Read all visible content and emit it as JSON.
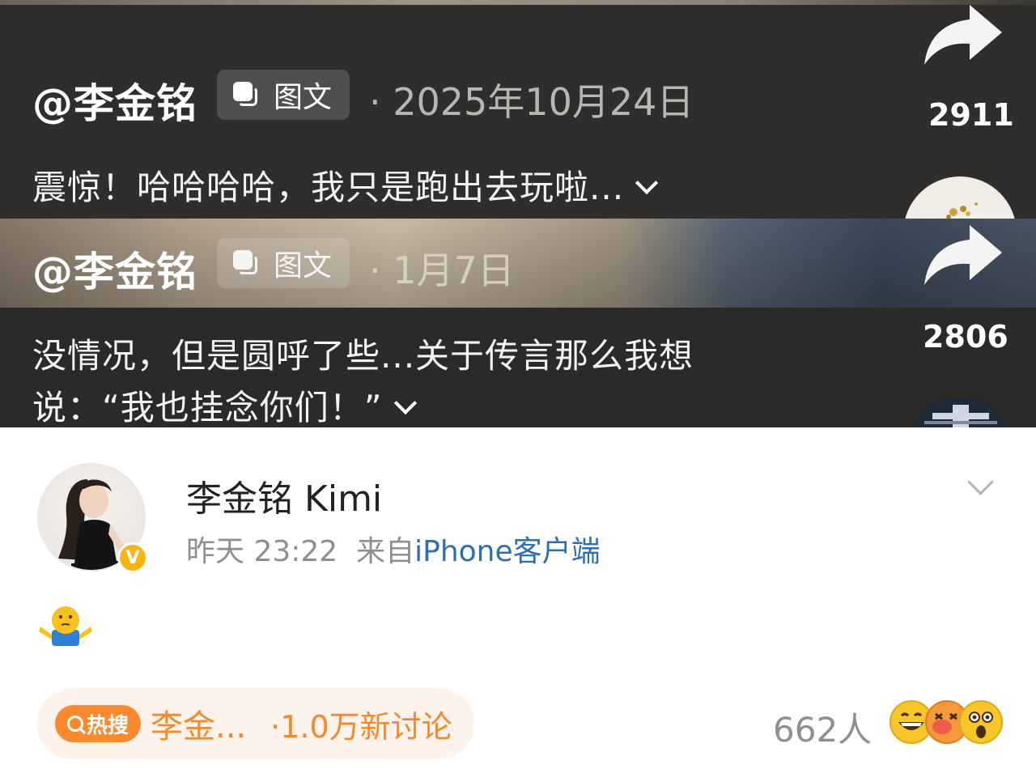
{
  "video_cards": [
    {
      "handle": "@李金铭",
      "tag": "图文",
      "date": "· 2025年10月24日",
      "caption": "震惊！哈哈哈哈，我只是跑出去玩啦...",
      "share_count": "2911"
    },
    {
      "handle": "@李金铭",
      "tag": "图文",
      "date": "· 1月7日",
      "caption_line1": "没情况，但是圆呼了些...关于传言那么我想",
      "caption_line2": "说：“我也挂念你们！”",
      "share_count": "2806"
    }
  ],
  "post": {
    "author": "李金铭 Kimi",
    "time": "昨天 23:22",
    "source_prefix": "来自",
    "source_client": "iPhone客户端",
    "verified_mark": "V",
    "body_emoji": "shrug-emoji"
  },
  "hot_search": {
    "badge": "热搜",
    "topic": "李金...",
    "discussion": "·1.0万新讨论"
  },
  "reactions": {
    "count": "662人",
    "icons": [
      "grin-emoji",
      "dizzy-emoji",
      "shock-emoji"
    ]
  },
  "colors": {
    "accent_orange": "#f3892e",
    "link_blue": "#2e6fb2",
    "verified_gold": "#f9b515"
  }
}
